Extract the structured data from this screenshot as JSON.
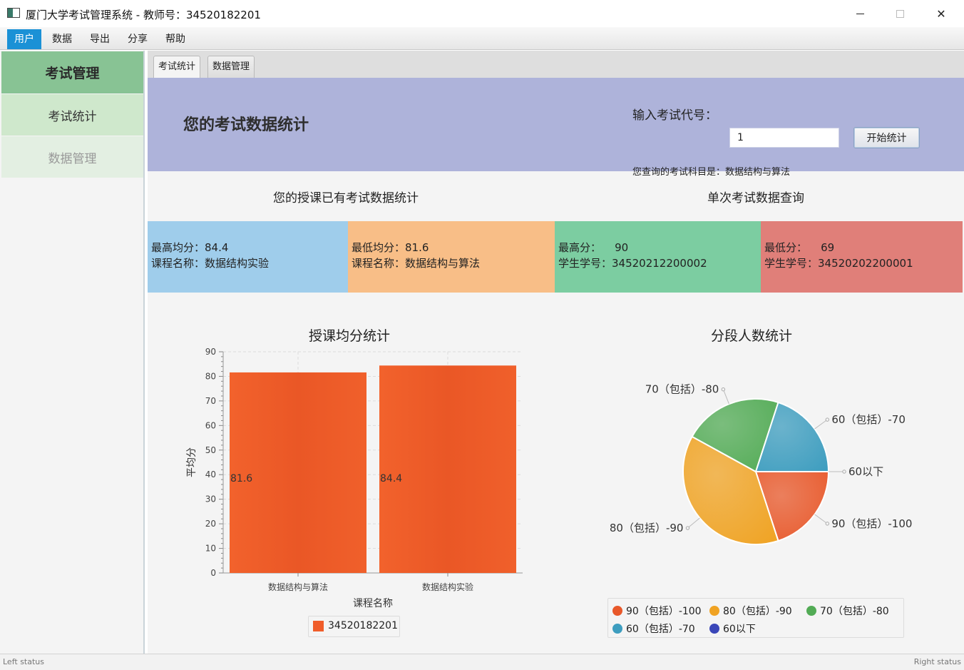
{
  "window": {
    "title": "厦门大学考试管理系统 - 教师号：34520182201",
    "minimize_icon": "minimize-icon",
    "maximize_icon": "maximize-icon",
    "close_icon": "close-icon",
    "close_glyph": "✕"
  },
  "menu": {
    "items": [
      "用户",
      "数据",
      "导出",
      "分享",
      "帮助"
    ],
    "active": "用户",
    "accent": "#1b91d6"
  },
  "sidebar": {
    "header": "考试管理",
    "items": [
      "考试统计",
      "数据管理"
    ],
    "colors": {
      "header": "#88c394",
      "active": "#cfe8cc",
      "inactive": "#e3efe2"
    }
  },
  "tabs": [
    "考试统计",
    "数据管理"
  ],
  "banner": {
    "title": "您的考试数据统计",
    "code_label": "输入考试代号：",
    "code_value": "1",
    "start_button": "开始统计",
    "subject_text": "您查询的考试科目是：数据结构与算法",
    "color": "#aeb3da"
  },
  "sections": {
    "left_title": "您的授课已有考试数据统计",
    "right_title": "单次考试数据查询"
  },
  "cards": [
    {
      "line1": "最高均分：84.4",
      "line2": "课程名称：数据结构实验",
      "color": "#9fcdeb"
    },
    {
      "line1": "最低均分：81.6",
      "line2": "课程名称：数据结构与算法",
      "color": "#f8be87"
    },
    {
      "line1": "最高分：    90",
      "line2": "学生学号：34520212200002",
      "color": "#7ccda1"
    },
    {
      "line1": "最低分：    69",
      "line2": "学生学号：34520202200001",
      "color": "#e07f79"
    }
  ],
  "chart_data": [
    {
      "type": "bar",
      "title": "授课均分统计",
      "xlabel": "课程名称",
      "ylabel": "平均分",
      "ylim": [
        0,
        90
      ],
      "yticks": [
        0,
        10,
        20,
        30,
        40,
        50,
        60,
        70,
        80,
        90
      ],
      "categories": [
        "数据结构与算法",
        "数据结构实验"
      ],
      "series": [
        {
          "name": "34520182201",
          "values": [
            81.6,
            84.4
          ],
          "color": "#f05d2a"
        }
      ],
      "data_labels": [
        "81.6",
        "84.4"
      ],
      "grid": true,
      "legend_position": "bottom"
    },
    {
      "type": "pie",
      "title": "分段人数统计",
      "slices": [
        {
          "label": "90（包括）-100",
          "value": 0.2,
          "color": "#e8582a"
        },
        {
          "label": "80（包括）-90",
          "value": 0.38,
          "color": "#f0a323"
        },
        {
          "label": "70（包括）-80",
          "value": 0.22,
          "color": "#52ab55"
        },
        {
          "label": "60（包括）-70",
          "value": 0.2,
          "color": "#3d9dbf"
        },
        {
          "label": "60以下",
          "value": 0.0,
          "color": "#3a46b8"
        }
      ],
      "legend_position": "bottom"
    }
  ],
  "status": {
    "left": "Left status",
    "right": "Right status"
  }
}
